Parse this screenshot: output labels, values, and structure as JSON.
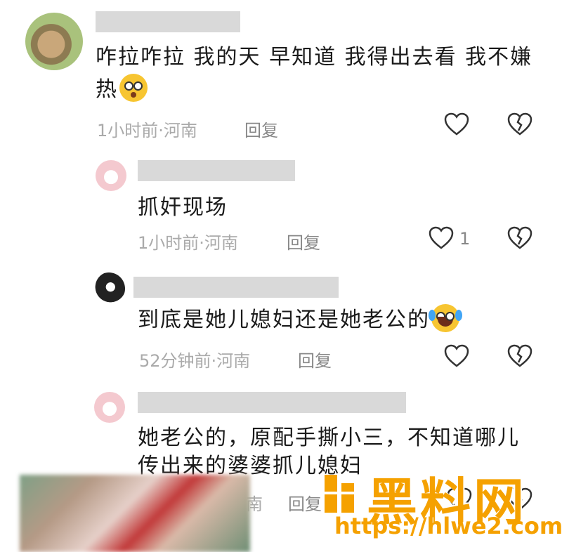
{
  "comments": [
    {
      "text": "咋拉咋拉 我的天 早知道 我得出去看 我不嫌",
      "text_line2": "热",
      "time": "1小时前",
      "separator": "·",
      "location": "河南",
      "reply_label": "回复"
    },
    {
      "text": "抓奸现场",
      "time": "1小时前",
      "separator": "·",
      "location": "河南",
      "reply_label": "回复",
      "like_count": "1"
    },
    {
      "text": "到底是她儿媳妇还是她老公的",
      "time": "52分钟前",
      "separator": "·",
      "location": "河南",
      "reply_label": "回复"
    },
    {
      "text": "她老公的，原配手撕小三，不知道哪儿",
      "text_line2": "传出来的婆婆抓儿媳妇",
      "location_partial": "南",
      "reply_label": "回复"
    }
  ],
  "watermark": {
    "logo_text": "黑料网",
    "url": "https://hlwe2.com"
  },
  "colors": {
    "accent": "#f5a100",
    "meta": "#aaaaaa",
    "placeholder": "#d9d9d9"
  }
}
